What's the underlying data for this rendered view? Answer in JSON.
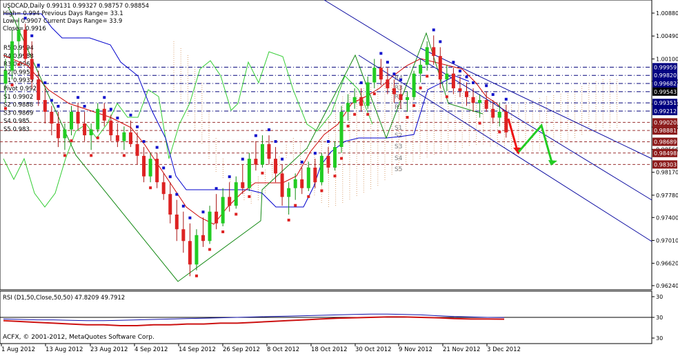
{
  "chart_data": {
    "type": "candlestick",
    "symbol": "USDCAD,Daily",
    "header": {
      "title_line": "USDCAD,Daily  0.99131 0.99327 0.98757 0.98854",
      "high_line": "High= 0.994    Previous Days Range= 33.1",
      "low_line": "Low= 0.9907    Current Days Range= 33.9",
      "close_line": "Close= 0.9916"
    },
    "pivot_labels_left": [
      "R5 0.9994",
      "R4 0.9988",
      "R3 0.9968",
      "R2 0.9954",
      "R1 0.9935",
      "Pivot 0.9921",
      "S1 0.9902",
      "S2 0.9888",
      "S3 0.9869",
      "S4 0.985",
      "S5 0.983"
    ],
    "pivot_labels_channel": [
      "R4",
      "R3",
      "R2",
      "R1",
      "S1",
      "S2",
      "S3",
      "S4",
      "S5"
    ],
    "price_axis_ticks": [
      "1.00880",
      "1.00490",
      "1.00100",
      "0.99720",
      "0.99330",
      "0.98940",
      "0.98560",
      "0.98170",
      "0.97780",
      "0.97400",
      "0.97010",
      "0.96620",
      "0.96240"
    ],
    "price_tags": [
      {
        "text": "0.99959",
        "color": "#000080"
      },
      {
        "text": "0.99820",
        "color": "#000080"
      },
      {
        "text": "0.99682",
        "color": "#000080"
      },
      {
        "text": "0.99543",
        "color": "#000000"
      },
      {
        "text": "0.99351",
        "color": "#000080"
      },
      {
        "text": "0.99212",
        "color": "#000080"
      },
      {
        "text": "0.99020",
        "color": "#8b1a1a"
      },
      {
        "text": "0.98881",
        "color": "#8b1a1a"
      },
      {
        "text": "0.98689",
        "color": "#8b1a1a"
      },
      {
        "text": "0.98498",
        "color": "#8b1a1a"
      },
      {
        "text": "0.98303",
        "color": "#8b1a1a"
      }
    ],
    "date_ticks": [
      "1 Aug 2012",
      "13 Aug 2012",
      "23 Aug 2012",
      "4 Sep 2012",
      "14 Sep 2012",
      "26 Sep 2012",
      "8 Oct 2012",
      "18 Oct 2012",
      "30 Oct 2012",
      "9 Nov 2012",
      "21 Nov 2012",
      "3 Dec 2012"
    ],
    "ohlc": [
      {
        "o": 0.9968,
        "h": 1.001,
        "l": 0.9935,
        "c": 0.999
      },
      {
        "o": 0.999,
        "h": 1.006,
        "l": 0.9975,
        "c": 1.004
      },
      {
        "o": 1.004,
        "h": 1.008,
        "l": 1.001,
        "c": 1.006
      },
      {
        "o": 1.006,
        "h": 1.007,
        "l": 1.0,
        "c": 1.001
      },
      {
        "o": 1.001,
        "h": 1.004,
        "l": 0.996,
        "c": 0.9975
      },
      {
        "o": 0.9975,
        "h": 0.999,
        "l": 0.993,
        "c": 0.994
      },
      {
        "o": 0.994,
        "h": 0.996,
        "l": 0.99,
        "c": 0.992
      },
      {
        "o": 0.992,
        "h": 0.993,
        "l": 0.988,
        "c": 0.99
      },
      {
        "o": 0.99,
        "h": 0.992,
        "l": 0.986,
        "c": 0.9875
      },
      {
        "o": 0.9875,
        "h": 0.99,
        "l": 0.9855,
        "c": 0.989
      },
      {
        "o": 0.989,
        "h": 0.993,
        "l": 0.988,
        "c": 0.992
      },
      {
        "o": 0.992,
        "h": 0.9935,
        "l": 0.989,
        "c": 0.99
      },
      {
        "o": 0.99,
        "h": 0.992,
        "l": 0.987,
        "c": 0.988
      },
      {
        "o": 0.988,
        "h": 0.99,
        "l": 0.9855,
        "c": 0.989
      },
      {
        "o": 0.989,
        "h": 0.9935,
        "l": 0.9885,
        "c": 0.9925
      },
      {
        "o": 0.9925,
        "h": 0.9935,
        "l": 0.9895,
        "c": 0.9905
      },
      {
        "o": 0.9905,
        "h": 0.9915,
        "l": 0.987,
        "c": 0.988
      },
      {
        "o": 0.988,
        "h": 0.99,
        "l": 0.986,
        "c": 0.987
      },
      {
        "o": 0.987,
        "h": 0.9895,
        "l": 0.9855,
        "c": 0.9885
      },
      {
        "o": 0.9885,
        "h": 0.9905,
        "l": 0.986,
        "c": 0.9865
      },
      {
        "o": 0.9865,
        "h": 0.9885,
        "l": 0.983,
        "c": 0.9845
      },
      {
        "o": 0.9845,
        "h": 0.986,
        "l": 0.98,
        "c": 0.981
      },
      {
        "o": 0.981,
        "h": 0.985,
        "l": 0.98,
        "c": 0.984
      },
      {
        "o": 0.984,
        "h": 0.985,
        "l": 0.979,
        "c": 0.98
      },
      {
        "o": 0.98,
        "h": 0.9815,
        "l": 0.977,
        "c": 0.978
      },
      {
        "o": 0.978,
        "h": 0.98,
        "l": 0.973,
        "c": 0.9745
      },
      {
        "o": 0.9745,
        "h": 0.977,
        "l": 0.97,
        "c": 0.972
      },
      {
        "o": 0.972,
        "h": 0.975,
        "l": 0.968,
        "c": 0.97
      },
      {
        "o": 0.97,
        "h": 0.973,
        "l": 0.964,
        "c": 0.966
      },
      {
        "o": 0.966,
        "h": 0.972,
        "l": 0.965,
        "c": 0.971
      },
      {
        "o": 0.971,
        "h": 0.974,
        "l": 0.969,
        "c": 0.97
      },
      {
        "o": 0.97,
        "h": 0.976,
        "l": 0.9695,
        "c": 0.975
      },
      {
        "o": 0.975,
        "h": 0.978,
        "l": 0.972,
        "c": 0.973
      },
      {
        "o": 0.973,
        "h": 0.979,
        "l": 0.9725,
        "c": 0.9775
      },
      {
        "o": 0.9775,
        "h": 0.98,
        "l": 0.975,
        "c": 0.976
      },
      {
        "o": 0.976,
        "h": 0.981,
        "l": 0.9755,
        "c": 0.98
      },
      {
        "o": 0.98,
        "h": 0.983,
        "l": 0.978,
        "c": 0.979
      },
      {
        "o": 0.979,
        "h": 0.985,
        "l": 0.9785,
        "c": 0.984
      },
      {
        "o": 0.984,
        "h": 0.987,
        "l": 0.982,
        "c": 0.983
      },
      {
        "o": 0.983,
        "h": 0.988,
        "l": 0.9825,
        "c": 0.9865
      },
      {
        "o": 0.9865,
        "h": 0.988,
        "l": 0.983,
        "c": 0.984
      },
      {
        "o": 0.984,
        "h": 0.986,
        "l": 0.98,
        "c": 0.9815
      },
      {
        "o": 0.9815,
        "h": 0.983,
        "l": 0.976,
        "c": 0.9775
      },
      {
        "o": 0.9775,
        "h": 0.98,
        "l": 0.9745,
        "c": 0.979
      },
      {
        "o": 0.979,
        "h": 0.9815,
        "l": 0.977,
        "c": 0.9805
      },
      {
        "o": 0.9805,
        "h": 0.9825,
        "l": 0.978,
        "c": 0.979
      },
      {
        "o": 0.979,
        "h": 0.9835,
        "l": 0.9785,
        "c": 0.9825
      },
      {
        "o": 0.9825,
        "h": 0.984,
        "l": 0.979,
        "c": 0.98
      },
      {
        "o": 0.98,
        "h": 0.985,
        "l": 0.9795,
        "c": 0.9845
      },
      {
        "o": 0.9845,
        "h": 0.986,
        "l": 0.9815,
        "c": 0.9825
      },
      {
        "o": 0.9825,
        "h": 0.987,
        "l": 0.982,
        "c": 0.986
      },
      {
        "o": 0.986,
        "h": 0.993,
        "l": 0.985,
        "c": 0.992
      },
      {
        "o": 0.992,
        "h": 0.995,
        "l": 0.9905,
        "c": 0.9935
      },
      {
        "o": 0.9935,
        "h": 0.996,
        "l": 0.9925,
        "c": 0.9945
      },
      {
        "o": 0.9945,
        "h": 0.996,
        "l": 0.992,
        "c": 0.993
      },
      {
        "o": 0.993,
        "h": 0.998,
        "l": 0.9925,
        "c": 0.997
      },
      {
        "o": 0.997,
        "h": 1.001,
        "l": 0.996,
        "c": 0.9995
      },
      {
        "o": 0.9995,
        "h": 1.001,
        "l": 0.9965,
        "c": 0.9975
      },
      {
        "o": 0.9975,
        "h": 0.9995,
        "l": 0.995,
        "c": 0.996
      },
      {
        "o": 0.996,
        "h": 0.9975,
        "l": 0.9935,
        "c": 0.995
      },
      {
        "o": 0.995,
        "h": 0.9965,
        "l": 0.9925,
        "c": 0.994
      },
      {
        "o": 0.994,
        "h": 0.9955,
        "l": 0.992,
        "c": 0.9945
      },
      {
        "o": 0.9945,
        "h": 0.999,
        "l": 0.994,
        "c": 0.9985
      },
      {
        "o": 0.9985,
        "h": 1.001,
        "l": 0.997,
        "c": 1.0
      },
      {
        "o": 1.0,
        "h": 1.004,
        "l": 0.999,
        "c": 1.003
      },
      {
        "o": 1.003,
        "h": 1.005,
        "l": 1.0,
        "c": 1.0015
      },
      {
        "o": 1.0015,
        "h": 1.003,
        "l": 0.996,
        "c": 0.9975
      },
      {
        "o": 0.9975,
        "h": 1.0,
        "l": 0.9955,
        "c": 0.9985
      },
      {
        "o": 0.9985,
        "h": 0.9995,
        "l": 0.995,
        "c": 0.996
      },
      {
        "o": 0.996,
        "h": 0.998,
        "l": 0.9945,
        "c": 0.9955
      },
      {
        "o": 0.9955,
        "h": 0.997,
        "l": 0.993,
        "c": 0.9945
      },
      {
        "o": 0.9945,
        "h": 0.996,
        "l": 0.992,
        "c": 0.9935
      },
      {
        "o": 0.9935,
        "h": 0.995,
        "l": 0.991,
        "c": 0.994
      },
      {
        "o": 0.994,
        "h": 0.9955,
        "l": 0.992,
        "c": 0.9925
      },
      {
        "o": 0.9925,
        "h": 0.994,
        "l": 0.99,
        "c": 0.991
      },
      {
        "o": 0.991,
        "h": 0.9935,
        "l": 0.9895,
        "c": 0.992
      },
      {
        "o": 0.992,
        "h": 0.9932,
        "l": 0.9876,
        "c": 0.9885
      }
    ],
    "rsi": {
      "label": "RSI (D1,50,Close,50,50) 47.8209 49.7912",
      "ticks": [
        "30",
        "30",
        "30"
      ],
      "line_a": [
        46,
        45,
        44,
        43,
        42,
        41,
        41,
        40,
        40,
        41,
        41,
        42,
        42,
        43,
        43,
        44,
        45,
        46,
        47,
        48,
        49,
        49.5,
        50,
        50.5,
        50.5,
        50,
        49.5,
        48.5,
        48,
        48,
        47.8
      ],
      "line_b": [
        48,
        47.5,
        47,
        47,
        46.5,
        46,
        46,
        46.5,
        47,
        47.5,
        48,
        48.5,
        49,
        49.5,
        50,
        50.5,
        51,
        51.5,
        52,
        52.5,
        53,
        53.5,
        54,
        54,
        53.5,
        53,
        52,
        51,
        50.5,
        50,
        49.8
      ]
    },
    "copyright": "ACFX, © 2001-2012, MetaQuotes Software Corp.",
    "colors": {
      "bull": "#22cc22",
      "bear": "#dd2222",
      "channel": "#0a0aa0",
      "cloud": "#d9a070",
      "chikou": "#33cc33",
      "kijun": "#0000cc",
      "tenkan": "#cc0000",
      "forecast": "#22cc22"
    }
  }
}
